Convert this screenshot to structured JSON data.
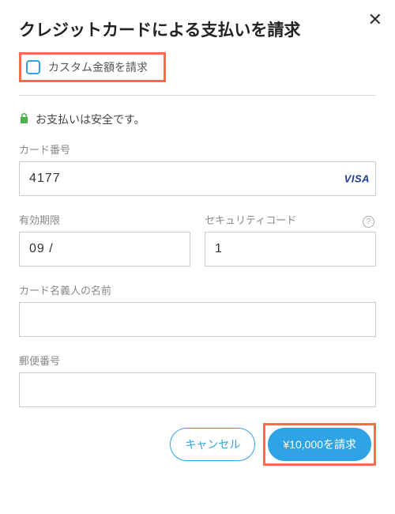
{
  "title": "クレジットカードによる支払いを請求",
  "custom_amount": {
    "label": "カスタム金額を請求"
  },
  "secure_text": "お支払いは安全です。",
  "card_number": {
    "label": "カード番号",
    "value": "4177",
    "brand": "VISA"
  },
  "expiry": {
    "label": "有効期限",
    "value": "09 / "
  },
  "cvc": {
    "label": "セキュリティコード",
    "value": "1"
  },
  "cardholder": {
    "label": "カード名義人の名前",
    "value": ""
  },
  "postal": {
    "label": "郵便番号",
    "value": ""
  },
  "buttons": {
    "cancel": "キャンセル",
    "submit": "¥10,000を請求"
  }
}
